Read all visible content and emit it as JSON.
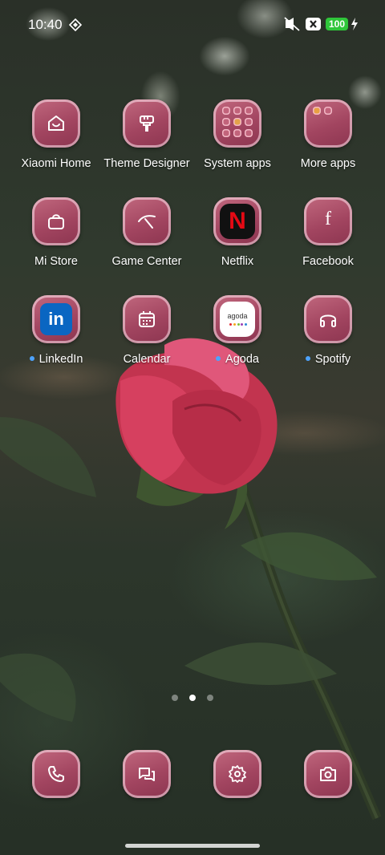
{
  "status_bar": {
    "time": "10:40",
    "battery": "100",
    "icons": [
      "ds-icon",
      "mute-icon",
      "close-box-icon",
      "battery-icon",
      "bolt-icon"
    ]
  },
  "apps": [
    {
      "label": "Xiaomi Home",
      "icon": "home-icon"
    },
    {
      "label": "Theme Designer",
      "icon": "paint-roller-icon"
    },
    {
      "label": "System apps",
      "icon": "folder-icon"
    },
    {
      "label": "More apps",
      "icon": "folder-icon"
    },
    {
      "label": "Mi Store",
      "icon": "shopping-bag-icon"
    },
    {
      "label": "Game Center",
      "icon": "game-center-icon"
    },
    {
      "label": "Netflix",
      "icon": "netflix-icon"
    },
    {
      "label": "Facebook",
      "icon": "facebook-icon"
    },
    {
      "label": "LinkedIn",
      "icon": "linkedin-icon",
      "new": true
    },
    {
      "label": "Calendar",
      "icon": "calendar-icon"
    },
    {
      "label": "Agoda",
      "icon": "agoda-icon",
      "new": true
    },
    {
      "label": "Spotify",
      "icon": "headphones-icon",
      "new": true
    }
  ],
  "netflix_letter": "N",
  "linkedin_text": "in",
  "facebook_letter": "f",
  "agoda_text": "agoda",
  "page_indicator": {
    "pages": 3,
    "active": 1
  },
  "dock": [
    {
      "name": "phone",
      "icon": "phone-icon"
    },
    {
      "name": "messages",
      "icon": "messages-icon"
    },
    {
      "name": "settings",
      "icon": "gear-icon"
    },
    {
      "name": "camera",
      "icon": "camera-icon"
    }
  ],
  "colors": {
    "tile": "#a24560",
    "battery": "#2fc63a",
    "new_dot": "#4da3ff",
    "netflix_red": "#e50914"
  }
}
